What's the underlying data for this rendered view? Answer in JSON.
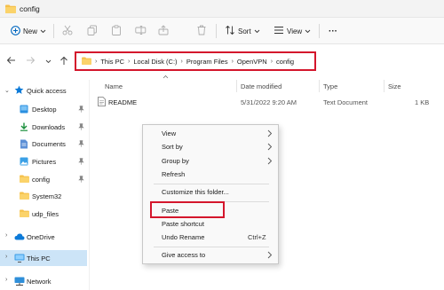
{
  "window": {
    "title": "config"
  },
  "toolbar": {
    "new_label": "New",
    "sort_label": "Sort",
    "view_label": "View",
    "more_label": "···"
  },
  "address": {
    "crumbs": [
      "This PC",
      "Local Disk (C:)",
      "Program Files",
      "OpenVPN",
      "config"
    ]
  },
  "sidebar": {
    "items": [
      {
        "label": "Quick access",
        "icon": "star-icon"
      },
      {
        "label": "Desktop",
        "icon": "desktop-icon"
      },
      {
        "label": "Downloads",
        "icon": "download-icon"
      },
      {
        "label": "Documents",
        "icon": "documents-icon"
      },
      {
        "label": "Pictures",
        "icon": "pictures-icon"
      },
      {
        "label": "config",
        "icon": "folder-icon"
      },
      {
        "label": "System32",
        "icon": "folder-icon"
      },
      {
        "label": "udp_files",
        "icon": "folder-icon"
      },
      {
        "label": "OneDrive",
        "icon": "cloud-icon"
      },
      {
        "label": "This PC",
        "icon": "computer-icon"
      },
      {
        "label": "Network",
        "icon": "network-icon"
      }
    ]
  },
  "columns": {
    "name": "Name",
    "date": "Date modified",
    "type": "Type",
    "size": "Size"
  },
  "files": [
    {
      "name": "README",
      "date": "5/31/2022 9:20 AM",
      "type": "Text Document",
      "size": "1 KB"
    }
  ],
  "context_menu": {
    "view": "View",
    "sort_by": "Sort by",
    "group_by": "Group by",
    "refresh": "Refresh",
    "customize": "Customize this folder...",
    "paste": "Paste",
    "paste_shortcut": "Paste shortcut",
    "undo_rename": "Undo Rename",
    "undo_shortcut": "Ctrl+Z",
    "give_access": "Give access to"
  },
  "colors": {
    "accent": "#0067c0",
    "highlight": "#d4162c",
    "selected": "#cce4f7",
    "folder": "#f5c04a"
  }
}
